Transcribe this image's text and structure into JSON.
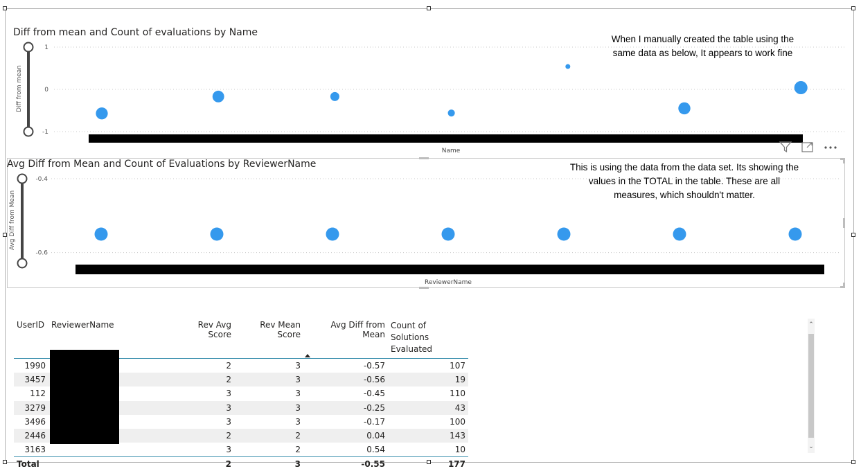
{
  "chart_data": [
    {
      "type": "scatter",
      "title": "Diff from mean and Count of evaluations by Name",
      "xlabel": "Name",
      "ylabel": "Diff from mean",
      "ylim": [
        -1,
        1
      ],
      "yticks": [
        "1",
        "0",
        "-1"
      ],
      "grid": true,
      "points": [
        {
          "y": -0.57,
          "size": 107
        },
        {
          "y": -0.17,
          "size": 100
        },
        {
          "y": -0.17,
          "size": 43
        },
        {
          "y": -0.56,
          "size": 19
        },
        {
          "y": 0.54,
          "size": 10
        },
        {
          "y": -0.45,
          "size": 110
        },
        {
          "y": 0.04,
          "size": 143
        }
      ]
    },
    {
      "type": "scatter",
      "title": "Avg Diff from Mean and Count of Evaluations by ReviewerName",
      "xlabel": "ReviewerName",
      "ylabel": "Avg Diff from Mean",
      "ylim": [
        -0.7,
        -0.4
      ],
      "yticks": [
        "-0.4",
        "-0.6"
      ],
      "grid": true,
      "points": [
        {
          "y": -0.55,
          "size": 177
        },
        {
          "y": -0.55,
          "size": 177
        },
        {
          "y": -0.55,
          "size": 177
        },
        {
          "y": -0.55,
          "size": 177
        },
        {
          "y": -0.55,
          "size": 177
        },
        {
          "y": -0.55,
          "size": 177
        },
        {
          "y": -0.55,
          "size": 177
        }
      ]
    }
  ],
  "annotations": {
    "top_line1": "When I manually created the table using the",
    "top_line2": "same data as below, It appears to work fine",
    "mid_line1": "This is using the data from the data set. Its showing the",
    "mid_line2": "values in the TOTAL in the table. These are all",
    "mid_line3": "measures, which shouldn't matter."
  },
  "table": {
    "headers": {
      "user_id": "UserID",
      "reviewer_name": "ReviewerName",
      "rev_avg": "Rev Avg Score",
      "rev_mean": "Rev Mean Score",
      "avg_diff": "Avg Diff from Mean",
      "count_line1": "Count of Solutions",
      "count_line2": "Evaluated"
    },
    "rows": [
      {
        "user_id": "1990",
        "rev_avg": "2",
        "rev_mean": "3",
        "avg_diff": "-0.57",
        "count": "107"
      },
      {
        "user_id": "3457",
        "rev_avg": "2",
        "rev_mean": "3",
        "avg_diff": "-0.56",
        "count": "19"
      },
      {
        "user_id": "112",
        "rev_avg": "3",
        "rev_mean": "3",
        "avg_diff": "-0.45",
        "count": "110"
      },
      {
        "user_id": "3279",
        "rev_avg": "3",
        "rev_mean": "3",
        "avg_diff": "-0.25",
        "count": "43"
      },
      {
        "user_id": "3496",
        "rev_avg": "3",
        "rev_mean": "3",
        "avg_diff": "-0.17",
        "count": "100"
      },
      {
        "user_id": "2446",
        "rev_avg": "2",
        "rev_mean": "2",
        "avg_diff": "0.04",
        "count": "143"
      },
      {
        "user_id": "3163",
        "rev_avg": "3",
        "rev_mean": "2",
        "avg_diff": "0.54",
        "count": "10"
      }
    ],
    "total": {
      "label": "Total",
      "rev_avg": "2",
      "rev_mean": "3",
      "avg_diff": "-0.55",
      "count": "177"
    }
  },
  "icons": {
    "filter": "filter-icon",
    "focus": "focus-mode-icon",
    "more": "more-options-icon",
    "sort": "sort-descending-icon"
  },
  "colors": {
    "point": "#3599ED",
    "accent": "#3A8FAE"
  }
}
